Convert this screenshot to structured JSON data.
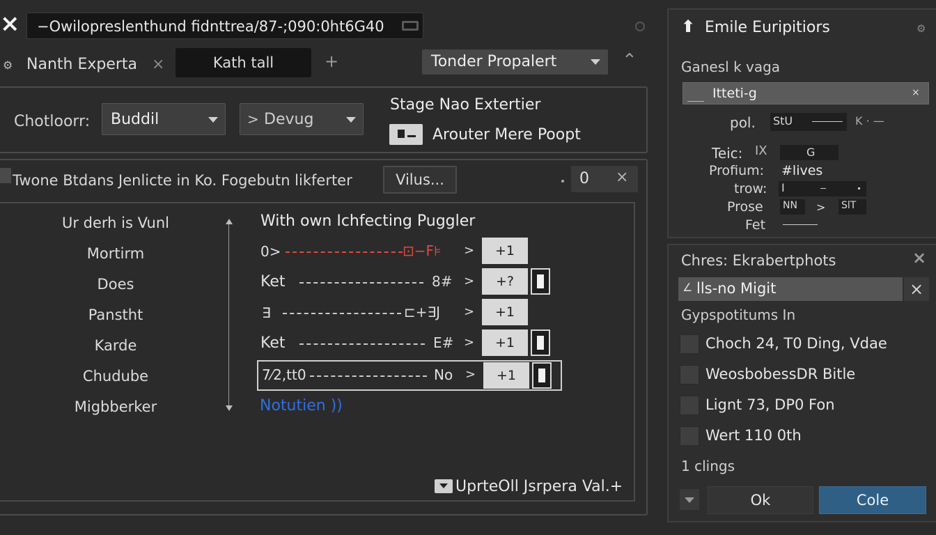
{
  "topbar": {
    "close_icon": "×",
    "address": "−Owilopreslenthund fidnttrea/87-;090:0ht6G40",
    "help_icon": "?"
  },
  "tabs": {
    "tab1_label": "Nanth Experta",
    "tab1_close": "×",
    "tab2_label": "Kath tall",
    "add": "+",
    "dropdown_value": "Tonder Propalert",
    "up_icon": "⌃"
  },
  "filters": {
    "label": "Chotloorr:",
    "select1_value": "Buddil",
    "select2_value": "Devug",
    "stage_title": "Stage Nao Extertier",
    "stage_button_text": "Arouter Mere Poopt"
  },
  "toolbar": {
    "description": "Twone Btdans Jenlicte in Ko. Fogebutn likferter",
    "button_label": "Vilus...",
    "count": "0",
    "clear": "×"
  },
  "list": {
    "items": [
      "Ur derh is Vunl",
      "Mortirm",
      "Does",
      "Panstht",
      "Karde",
      "Chudube",
      "Migbberker"
    ],
    "heading": "With own Ichfecting Puggler",
    "rows": [
      {
        "label": "0>",
        "end": "⊡−F⊧",
        "value": "+1",
        "has_box": false,
        "red": true
      },
      {
        "label": "Ket",
        "end": "8#",
        "value": "+?",
        "has_box": true,
        "red": false
      },
      {
        "label": "∃",
        "end": "⊏+∃J",
        "value": "+1",
        "has_box": false,
        "red": false
      },
      {
        "label": "Ket",
        "end": "E#",
        "value": "+1",
        "has_box": true,
        "red": false
      },
      {
        "label": "7⁄2,tt0",
        "end": "No",
        "value": "+1",
        "has_box": true,
        "red": false
      }
    ],
    "link_text": "Notutien",
    "footer_text": "Uprt͏eOll Jsrpera Val.+"
  },
  "sidepanel": {
    "title": "Emile Euripitiors",
    "section_label": "Ganesl k vaga",
    "input_value": "Itteti-g",
    "props": [
      {
        "label": "pol.",
        "value": "StU"
      },
      {
        "label": "Teic:",
        "value": "G"
      },
      {
        "label": "Profium:",
        "value": "#lives"
      },
      {
        "label": "trow:",
        "value": "I"
      },
      {
        "label": "Prose",
        "value": "NN"
      },
      {
        "label": "Fet",
        "value": ""
      }
    ],
    "prose_value2": "SlT"
  },
  "chres": {
    "title": "Chres: Ekrabertphots",
    "search_value": "lls-no Migit",
    "group_label": "Gypspotitums  In",
    "options": [
      "Choch 24, T0 Ding, Vdae",
      "WeosbobessDR Bitle",
      "Lignt 73, DP0 Fon",
      "Wert 110 0th"
    ],
    "count_text": "1 clings",
    "ok_label": "Ok",
    "cole_label": "Cole"
  },
  "colors": {
    "background": "#2b2b2c",
    "accent_blue": "#2f5f85",
    "link_blue": "#2e6fe0",
    "red": "#e04a3f"
  }
}
